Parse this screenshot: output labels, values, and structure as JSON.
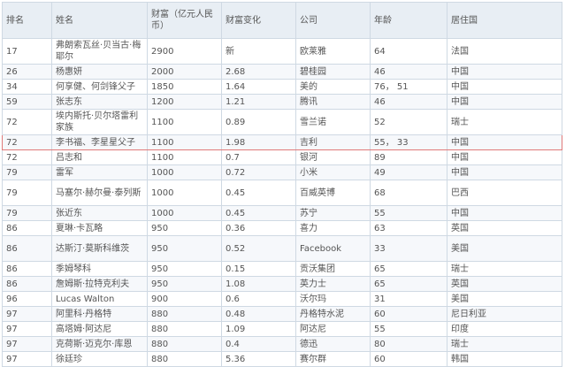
{
  "headers": [
    "排名",
    "姓名",
    "财富（亿元人民币）",
    "财富变化",
    "公司",
    "年龄",
    "居住国"
  ],
  "rows": [
    {
      "rank": "17",
      "name": "弗朗索瓦丝·贝当古·梅耶尔",
      "wealth": "2900",
      "change": "新",
      "company": "欧莱雅",
      "age": "64",
      "country": "法国"
    },
    {
      "rank": "26",
      "name": "杨惠妍",
      "wealth": "2000",
      "change": "2.68",
      "company": "碧桂园",
      "age": "46",
      "country": "中国"
    },
    {
      "rank": "34",
      "name": "何享健、何剑锋父子",
      "wealth": "1850",
      "change": "1.64",
      "company": "美的",
      "age": "76，  51",
      "country": "中国"
    },
    {
      "rank": "59",
      "name": "张志东",
      "wealth": "1200",
      "change": "1.21",
      "company": "腾讯",
      "age": "46",
      "country": "中国"
    },
    {
      "rank": "72",
      "name": "埃内斯托·贝尔塔雷利家族",
      "wealth": "1100",
      "change": "0.89",
      "company": "雪兰诺",
      "age": "52",
      "country": "瑞士"
    },
    {
      "rank": "72",
      "name": "李书福、李星星父子",
      "wealth": "1100",
      "change": "1.98",
      "company": "吉利",
      "age": "55，  33",
      "country": "中国"
    },
    {
      "rank": "72",
      "name": "吕志和",
      "wealth": "1100",
      "change": "0.7",
      "company": "银河",
      "age": "89",
      "country": "中国"
    },
    {
      "rank": "79",
      "name": "雷军",
      "wealth": "1000",
      "change": "0.72",
      "company": "小米",
      "age": "49",
      "country": "中国"
    },
    {
      "rank": "79",
      "name": "马塞尔·赫尔曼·泰列斯",
      "wealth": "1000",
      "change": "0.45",
      "company": "百威英博",
      "age": "68",
      "country": "巴西"
    },
    {
      "rank": "79",
      "name": "张近东",
      "wealth": "1000",
      "change": "0.45",
      "company": "苏宁",
      "age": "55",
      "country": "中国"
    },
    {
      "rank": "86",
      "name": "夏琳·卡瓦略",
      "wealth": "950",
      "change": "0.36",
      "company": "喜力",
      "age": "63",
      "country": "英国"
    },
    {
      "rank": "86",
      "name": "达斯汀·莫斯科维茨",
      "wealth": "950",
      "change": "0.52",
      "company": "Facebook",
      "age": "33",
      "country": "美国"
    },
    {
      "rank": "86",
      "name": "季姆琴科",
      "wealth": "950",
      "change": "0.15",
      "company": "贡沃集团",
      "age": "65",
      "country": "瑞士"
    },
    {
      "rank": "86",
      "name": "詹姆斯·拉特克利夫",
      "wealth": "950",
      "change": "1.08",
      "company": "英力士",
      "age": "65",
      "country": "英国"
    },
    {
      "rank": "96",
      "name": "Lucas Walton",
      "wealth": "900",
      "change": "0.6",
      "company": "沃尔玛",
      "age": "31",
      "country": "美国"
    },
    {
      "rank": "97",
      "name": "阿里科·丹格特",
      "wealth": "880",
      "change": "0.48",
      "company": "丹格特水泥",
      "age": "60",
      "country": "尼日利亚"
    },
    {
      "rank": "97",
      "name": "高塔姆·阿达尼",
      "wealth": "880",
      "change": "1.09",
      "company": "阿达尼",
      "age": "55",
      "country": "印度"
    },
    {
      "rank": "97",
      "name": "克荷斯·迈克尔·库恩",
      "wealth": "880",
      "change": "0.4",
      "company": "德迅",
      "age": "80",
      "country": "瑞士"
    },
    {
      "rank": "97",
      "name": "徐廷珍",
      "wealth": "880",
      "change": "5.36",
      "company": "赛尔群",
      "age": "60",
      "country": "韩国"
    }
  ]
}
